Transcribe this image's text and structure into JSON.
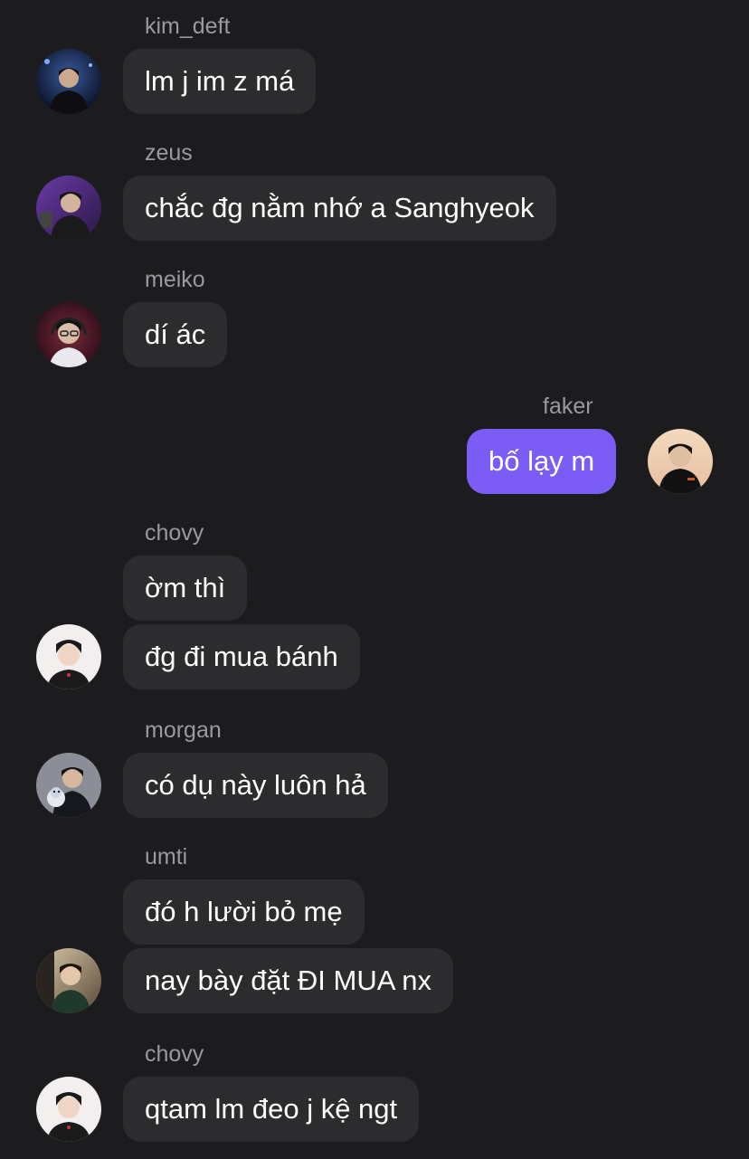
{
  "messages": [
    {
      "sender": "kim_deft",
      "text": "lm j im z má"
    },
    {
      "sender": "zeus",
      "text": "chắc đg nằm nhớ a Sanghyeok"
    },
    {
      "sender": "meiko",
      "text": "dí ác"
    },
    {
      "sender": "faker",
      "text": "bố lạy m",
      "outgoing": true
    },
    {
      "sender": "chovy",
      "texts": [
        "ờm thì",
        "đg đi mua bánh"
      ]
    },
    {
      "sender": "morgan",
      "text": "có dụ này luôn hả"
    },
    {
      "sender": "umti",
      "texts": [
        "đó h lười bỏ mẹ",
        "nay bày đặt ĐI MUA nx"
      ]
    },
    {
      "sender": "chovy",
      "text": "qtam lm đeo j kệ ngt"
    }
  ],
  "colors": {
    "background": "#1c1c1e",
    "incoming_bubble": "#2c2c2e",
    "outgoing_bubble": "#7b5cf5",
    "sender_name": "#9a9a9e"
  }
}
